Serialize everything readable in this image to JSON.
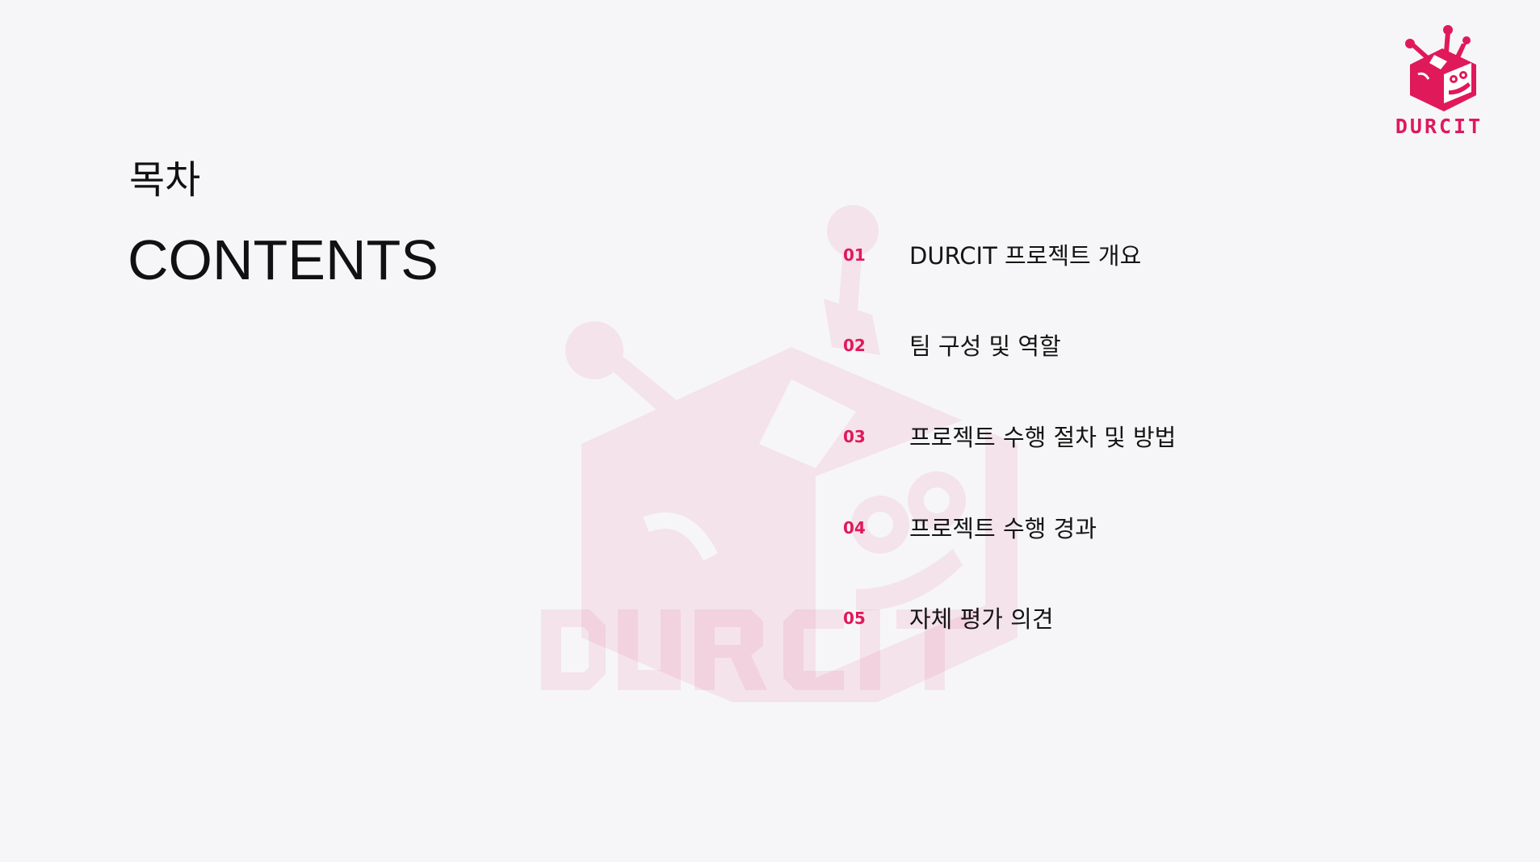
{
  "brand": {
    "name": "DURCIT",
    "accent_color": "#e0195a",
    "logo_icon": "robot-box-icon"
  },
  "heading": {
    "korean": "목차",
    "english": "CONTENTS"
  },
  "contents": [
    {
      "number": "01",
      "label": "DURCIT 프로젝트 개요"
    },
    {
      "number": "02",
      "label": "팀 구성 및 역할"
    },
    {
      "number": "03",
      "label": "프로젝트 수행 절차 및 방법"
    },
    {
      "number": "04",
      "label": "프로젝트 수행 경과"
    },
    {
      "number": "05",
      "label": "자체 평가 의견"
    }
  ],
  "colors": {
    "background": "#f6f6f8",
    "text": "#111111",
    "accent": "#e0195a"
  }
}
